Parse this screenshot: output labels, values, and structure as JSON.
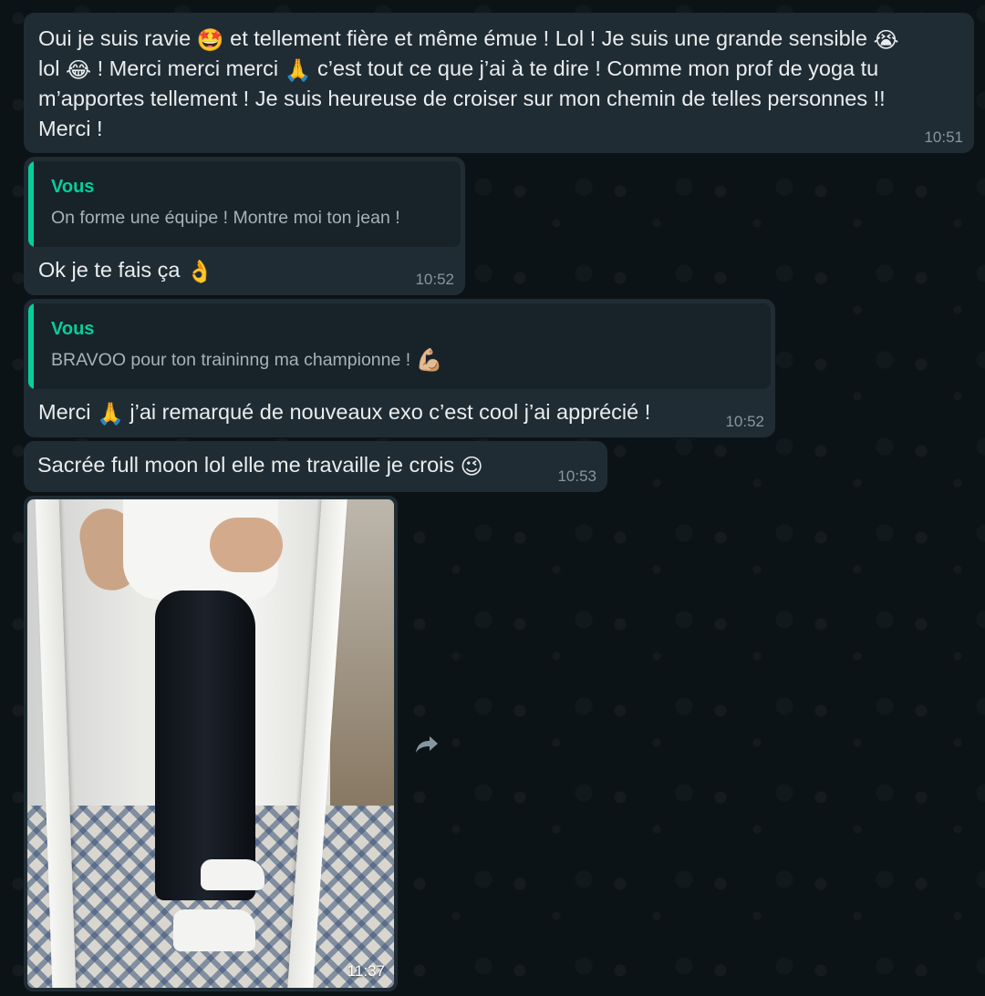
{
  "messages": [
    {
      "id": "m1",
      "text_parts": [
        "Oui je suis ravie ",
        " et tellement fière et même émue ! Lol ! Je suis une grande sensible ",
        "\nlol ",
        " ! Merci merci merci ",
        " c’est tout ce que j’ai à te dire ! Comme mon prof de yoga tu\nm’apportes tellement ! Je suis heureuse de croiser sur mon chemin de telles personnes !!\nMerci !"
      ],
      "emojis": [
        "🤩",
        "😭",
        "😂",
        "🙏"
      ],
      "time": "10:51"
    },
    {
      "id": "m2",
      "quote": {
        "author": "Vous",
        "text": "On forme une équipe ! Montre moi ton jean !"
      },
      "text": "Ok je te fais ça",
      "emoji": "👌",
      "time": "10:52"
    },
    {
      "id": "m3",
      "quote": {
        "author": "Vous",
        "text": "BRAVOO pour ton traininng ma championne !",
        "emoji": "💪🏼"
      },
      "text_before": "Merci",
      "emoji": "🙏",
      "text_after": "j’ai remarqué de nouveaux exo c’est cool j’ai apprécié !",
      "time": "10:52"
    },
    {
      "id": "m4",
      "text": "Sacrée full moon lol elle me travaille je crois",
      "emoji": "😉",
      "time": "10:53"
    },
    {
      "id": "m5",
      "type": "photo",
      "time": "11:37"
    }
  ],
  "icons": {
    "forward": "forward-arrow-icon"
  },
  "colors": {
    "bubble": "#202c33",
    "quote_bg": "#182229",
    "quote_accent": "#06cf9c",
    "time": "#8696a0",
    "text": "#e9edef"
  }
}
